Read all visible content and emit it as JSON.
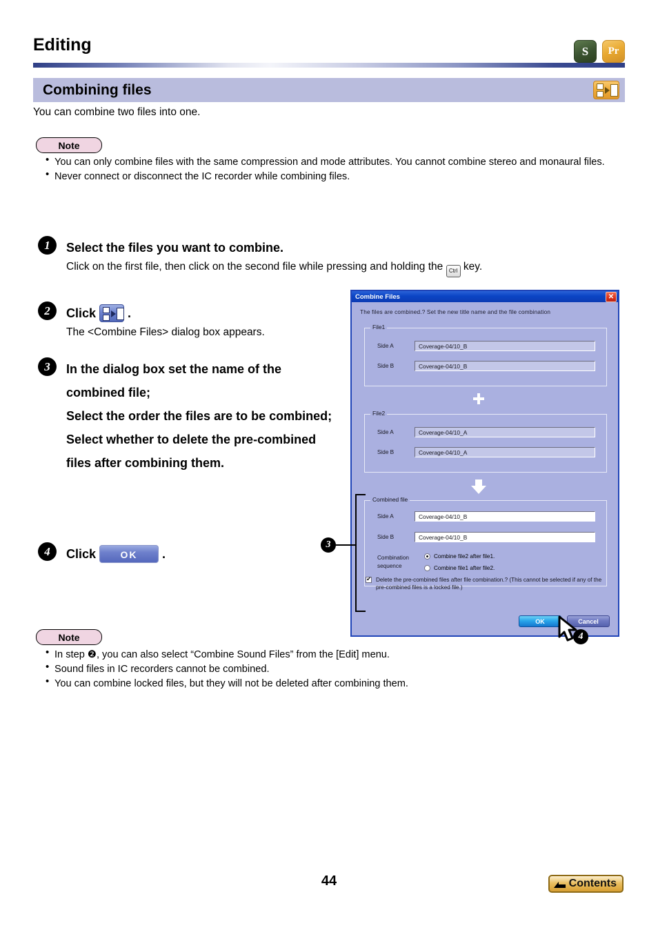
{
  "header": {
    "chapter_title": "Editing",
    "badges": [
      {
        "name": "badge-s",
        "label": "S"
      },
      {
        "name": "badge-pr",
        "label": "Pr"
      }
    ]
  },
  "section": {
    "title": "Combining files",
    "icon": "combine-files-icon"
  },
  "intro_text": "You can combine two files into one.",
  "note1": {
    "label": "Note",
    "items": [
      "You can only combine files with the same compression and mode attributes. You cannot combine stereo and monaural files.",
      "Never connect or disconnect the IC recorder while combining files."
    ]
  },
  "steps": {
    "step1": {
      "num": "1",
      "heading": "Select the files you want to combine.",
      "sub_before": "Click on the first file, then click on the second file while pressing and holding the",
      "key_label": "Ctrl",
      "sub_after": "key."
    },
    "step2": {
      "num": "2",
      "heading": "Click",
      "heading_after": ".",
      "sub": "The <Combine Files> dialog box appears."
    },
    "step3": {
      "num": "3",
      "lines": [
        "In the dialog box set the name of the combined file;",
        "Select the order the files are to be combined;",
        "Select whether to delete the pre-combined files after combining them."
      ]
    },
    "step4": {
      "num": "4",
      "heading": "Click",
      "button_label": "OK",
      "heading_after": "."
    }
  },
  "callouts": {
    "three": "3",
    "four": "4"
  },
  "dialog": {
    "title": "Combine Files",
    "close_label": "✕",
    "description": "The files are combined.? Set the new title name and the file combination",
    "file1": {
      "legend": "File1",
      "side_a_label": "Side A",
      "side_a_value": "Coverage-04/10_B",
      "side_b_label": "Side B",
      "side_b_value": "Coverage-04/10_B"
    },
    "operator_plus": "+",
    "file2": {
      "legend": "File2",
      "side_a_label": "Side A",
      "side_a_value": "Coverage-04/10_A",
      "side_b_label": "Side B",
      "side_b_value": "Coverage-04/10_A"
    },
    "combined": {
      "legend": "Combined file",
      "side_a_label": "Side A",
      "side_a_value": "Coverage-04/10_B",
      "side_b_label": "Side B",
      "side_b_value": "Coverage-04/10_B",
      "sequence_label_line1": "Combination",
      "sequence_label_line2": "sequence",
      "option1": "Combine file2 after file1.",
      "option2": "Combine file1 after file2.",
      "selected_option": 0
    },
    "delete_checkbox": {
      "checked": true,
      "text": "Delete the pre-combined files after file combination.? (This cannot be selected if any of the pre-combined files is a locked file.)"
    },
    "buttons": {
      "ok": "OK",
      "cancel": "Cancel"
    }
  },
  "note2": {
    "label": "Note",
    "items": [
      "In step ❷, you can also select “Combine Sound Files” from the [Edit] menu.",
      "Sound files in IC recorders cannot be combined.",
      "You can combine locked files, but they will not be deleted after combining them."
    ]
  },
  "footer": {
    "page_number": "44",
    "contents_label": "Contents"
  },
  "colors": {
    "section_bar": "#b9bcdd",
    "rule_accent": "#2f3f86",
    "note_pill": "#f0d5e2",
    "dialog_face": "#aab0e0",
    "dialog_titlebar": "#0b44c4",
    "contents_gold": "#eabf62"
  }
}
